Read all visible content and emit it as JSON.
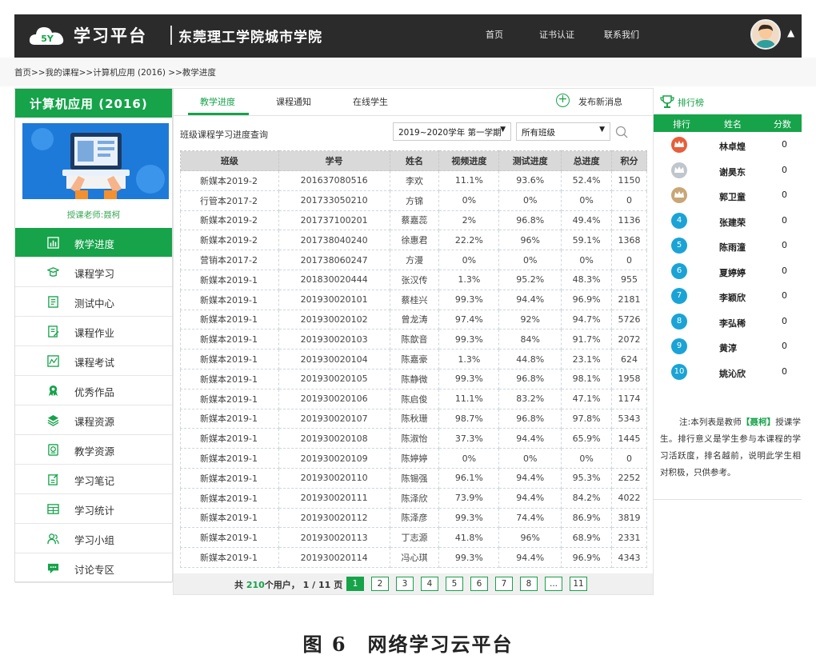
{
  "header": {
    "logo_badge": "5Y",
    "logo_text": "学习平台",
    "school_name": "东莞理工学院城市学院",
    "nav": [
      "首页",
      "证书认证",
      "联系我们"
    ]
  },
  "breadcrumb": "首页>>我的课程>>计算机应用 (2016) >>教学进度",
  "sidebar": {
    "course_title": "计算机应用 (2016)",
    "teacher": "授课老师:聂柯",
    "items": [
      {
        "label": "教学进度",
        "icon": "chart-bar-icon"
      },
      {
        "label": "课程学习",
        "icon": "graduation-cap-icon"
      },
      {
        "label": "测试中心",
        "icon": "test-doc-icon"
      },
      {
        "label": "课程作业",
        "icon": "homework-icon"
      },
      {
        "label": "课程考试",
        "icon": "exam-icon"
      },
      {
        "label": "优秀作品",
        "icon": "award-icon"
      },
      {
        "label": "课程资源",
        "icon": "layers-icon"
      },
      {
        "label": "教学资源",
        "icon": "resource-icon"
      },
      {
        "label": "学习笔记",
        "icon": "note-icon"
      },
      {
        "label": "学习统计",
        "icon": "stats-icon"
      },
      {
        "label": "学习小组",
        "icon": "group-icon"
      },
      {
        "label": "讨论专区",
        "icon": "chat-icon"
      }
    ]
  },
  "tabs": [
    "教学进度",
    "课程通知",
    "在线学生"
  ],
  "publish_label": "发布新消息",
  "query": {
    "title": "班级课程学习进度查询",
    "term_select": "2019~2020学年 第一学期",
    "class_select": "所有班级"
  },
  "table": {
    "headers": [
      "班级",
      "学号",
      "姓名",
      "视频进度",
      "测试进度",
      "总进度",
      "积分"
    ],
    "rows": [
      [
        "新媒本2019-2",
        "201637080516",
        "李欢",
        "11.1%",
        "93.6%",
        "52.4%",
        "1150"
      ],
      [
        "行管本2017-2",
        "201733050210",
        "方锦",
        "0%",
        "0%",
        "0%",
        "0"
      ],
      [
        "新媒本2019-2",
        "201737100201",
        "蔡嘉蕊",
        "2%",
        "96.8%",
        "49.4%",
        "1136"
      ],
      [
        "新媒本2019-2",
        "201738040240",
        "徐惠君",
        "22.2%",
        "96%",
        "59.1%",
        "1368"
      ],
      [
        "营销本2017-2",
        "201738060247",
        "方漫",
        "0%",
        "0%",
        "0%",
        "0"
      ],
      [
        "新媒本2019-1",
        "201830020444",
        "张汉传",
        "1.3%",
        "95.2%",
        "48.3%",
        "955"
      ],
      [
        "新媒本2019-1",
        "201930020101",
        "蔡桂兴",
        "99.3%",
        "94.4%",
        "96.9%",
        "2181"
      ],
      [
        "新媒本2019-1",
        "201930020102",
        "曾龙涛",
        "97.4%",
        "92%",
        "94.7%",
        "5726"
      ],
      [
        "新媒本2019-1",
        "201930020103",
        "陈歆音",
        "99.3%",
        "84%",
        "91.7%",
        "2072"
      ],
      [
        "新媒本2019-1",
        "201930020104",
        "陈嘉豪",
        "1.3%",
        "44.8%",
        "23.1%",
        "624"
      ],
      [
        "新媒本2019-1",
        "201930020105",
        "陈静微",
        "99.3%",
        "96.8%",
        "98.1%",
        "1958"
      ],
      [
        "新媒本2019-1",
        "201930020106",
        "陈启俊",
        "11.1%",
        "83.2%",
        "47.1%",
        "1174"
      ],
      [
        "新媒本2019-1",
        "201930020107",
        "陈秋珊",
        "98.7%",
        "96.8%",
        "97.8%",
        "5343"
      ],
      [
        "新媒本2019-1",
        "201930020108",
        "陈淑怡",
        "37.3%",
        "94.4%",
        "65.9%",
        "1445"
      ],
      [
        "新媒本2019-1",
        "201930020109",
        "陈婷婷",
        "0%",
        "0%",
        "0%",
        "0"
      ],
      [
        "新媒本2019-1",
        "201930020110",
        "陈锡强",
        "96.1%",
        "94.4%",
        "95.3%",
        "2252"
      ],
      [
        "新媒本2019-1",
        "201930020111",
        "陈泽欣",
        "73.9%",
        "94.4%",
        "84.2%",
        "4022"
      ],
      [
        "新媒本2019-1",
        "201930020112",
        "陈泽彦",
        "99.3%",
        "74.4%",
        "86.9%",
        "3819"
      ],
      [
        "新媒本2019-1",
        "201930020113",
        "丁志源",
        "41.8%",
        "96%",
        "68.9%",
        "2331"
      ],
      [
        "新媒本2019-1",
        "201930020114",
        "冯心琪",
        "99.3%",
        "94.4%",
        "96.9%",
        "4343"
      ]
    ]
  },
  "pager": {
    "prefix": "共",
    "total": "210",
    "middle": "个用户，",
    "page": "1",
    "sep": "/",
    "pages": "11",
    "suffix": "页",
    "buttons": [
      "1",
      "2",
      "3",
      "4",
      "5",
      "6",
      "7",
      "8",
      "...",
      "11"
    ]
  },
  "ranking": {
    "title": "排行榜",
    "headers": [
      "排行",
      "姓名",
      "分数"
    ],
    "rows": [
      {
        "badge": "",
        "name": "林卓煌",
        "score": "0"
      },
      {
        "badge": "",
        "name": "谢昊东",
        "score": "0"
      },
      {
        "badge": "",
        "name": "郭卫童",
        "score": "0"
      },
      {
        "badge": "4",
        "name": "张建荣",
        "score": "0"
      },
      {
        "badge": "5",
        "name": "陈雨潼",
        "score": "0"
      },
      {
        "badge": "6",
        "name": "夏婷婷",
        "score": "0"
      },
      {
        "badge": "7",
        "name": "李颖欣",
        "score": "0"
      },
      {
        "badge": "8",
        "name": "李弘稀",
        "score": "0"
      },
      {
        "badge": "9",
        "name": "黄淳",
        "score": "0"
      },
      {
        "badge": "10",
        "name": "姚沁欣",
        "score": "0"
      }
    ],
    "note_prefix": "注:本列表是教师",
    "note_teacher": "【聂柯】",
    "note_suffix": "授课学生。排行意义是学生参与本课程的学习活跃度，排名越前，说明此学生相对积极，只供参考。"
  },
  "caption": "图 6　网络学习云平台",
  "colors": {
    "accent": "#16a34a",
    "header_bg": "#2b2b2b",
    "badge_blue": "#1ba3d6"
  }
}
